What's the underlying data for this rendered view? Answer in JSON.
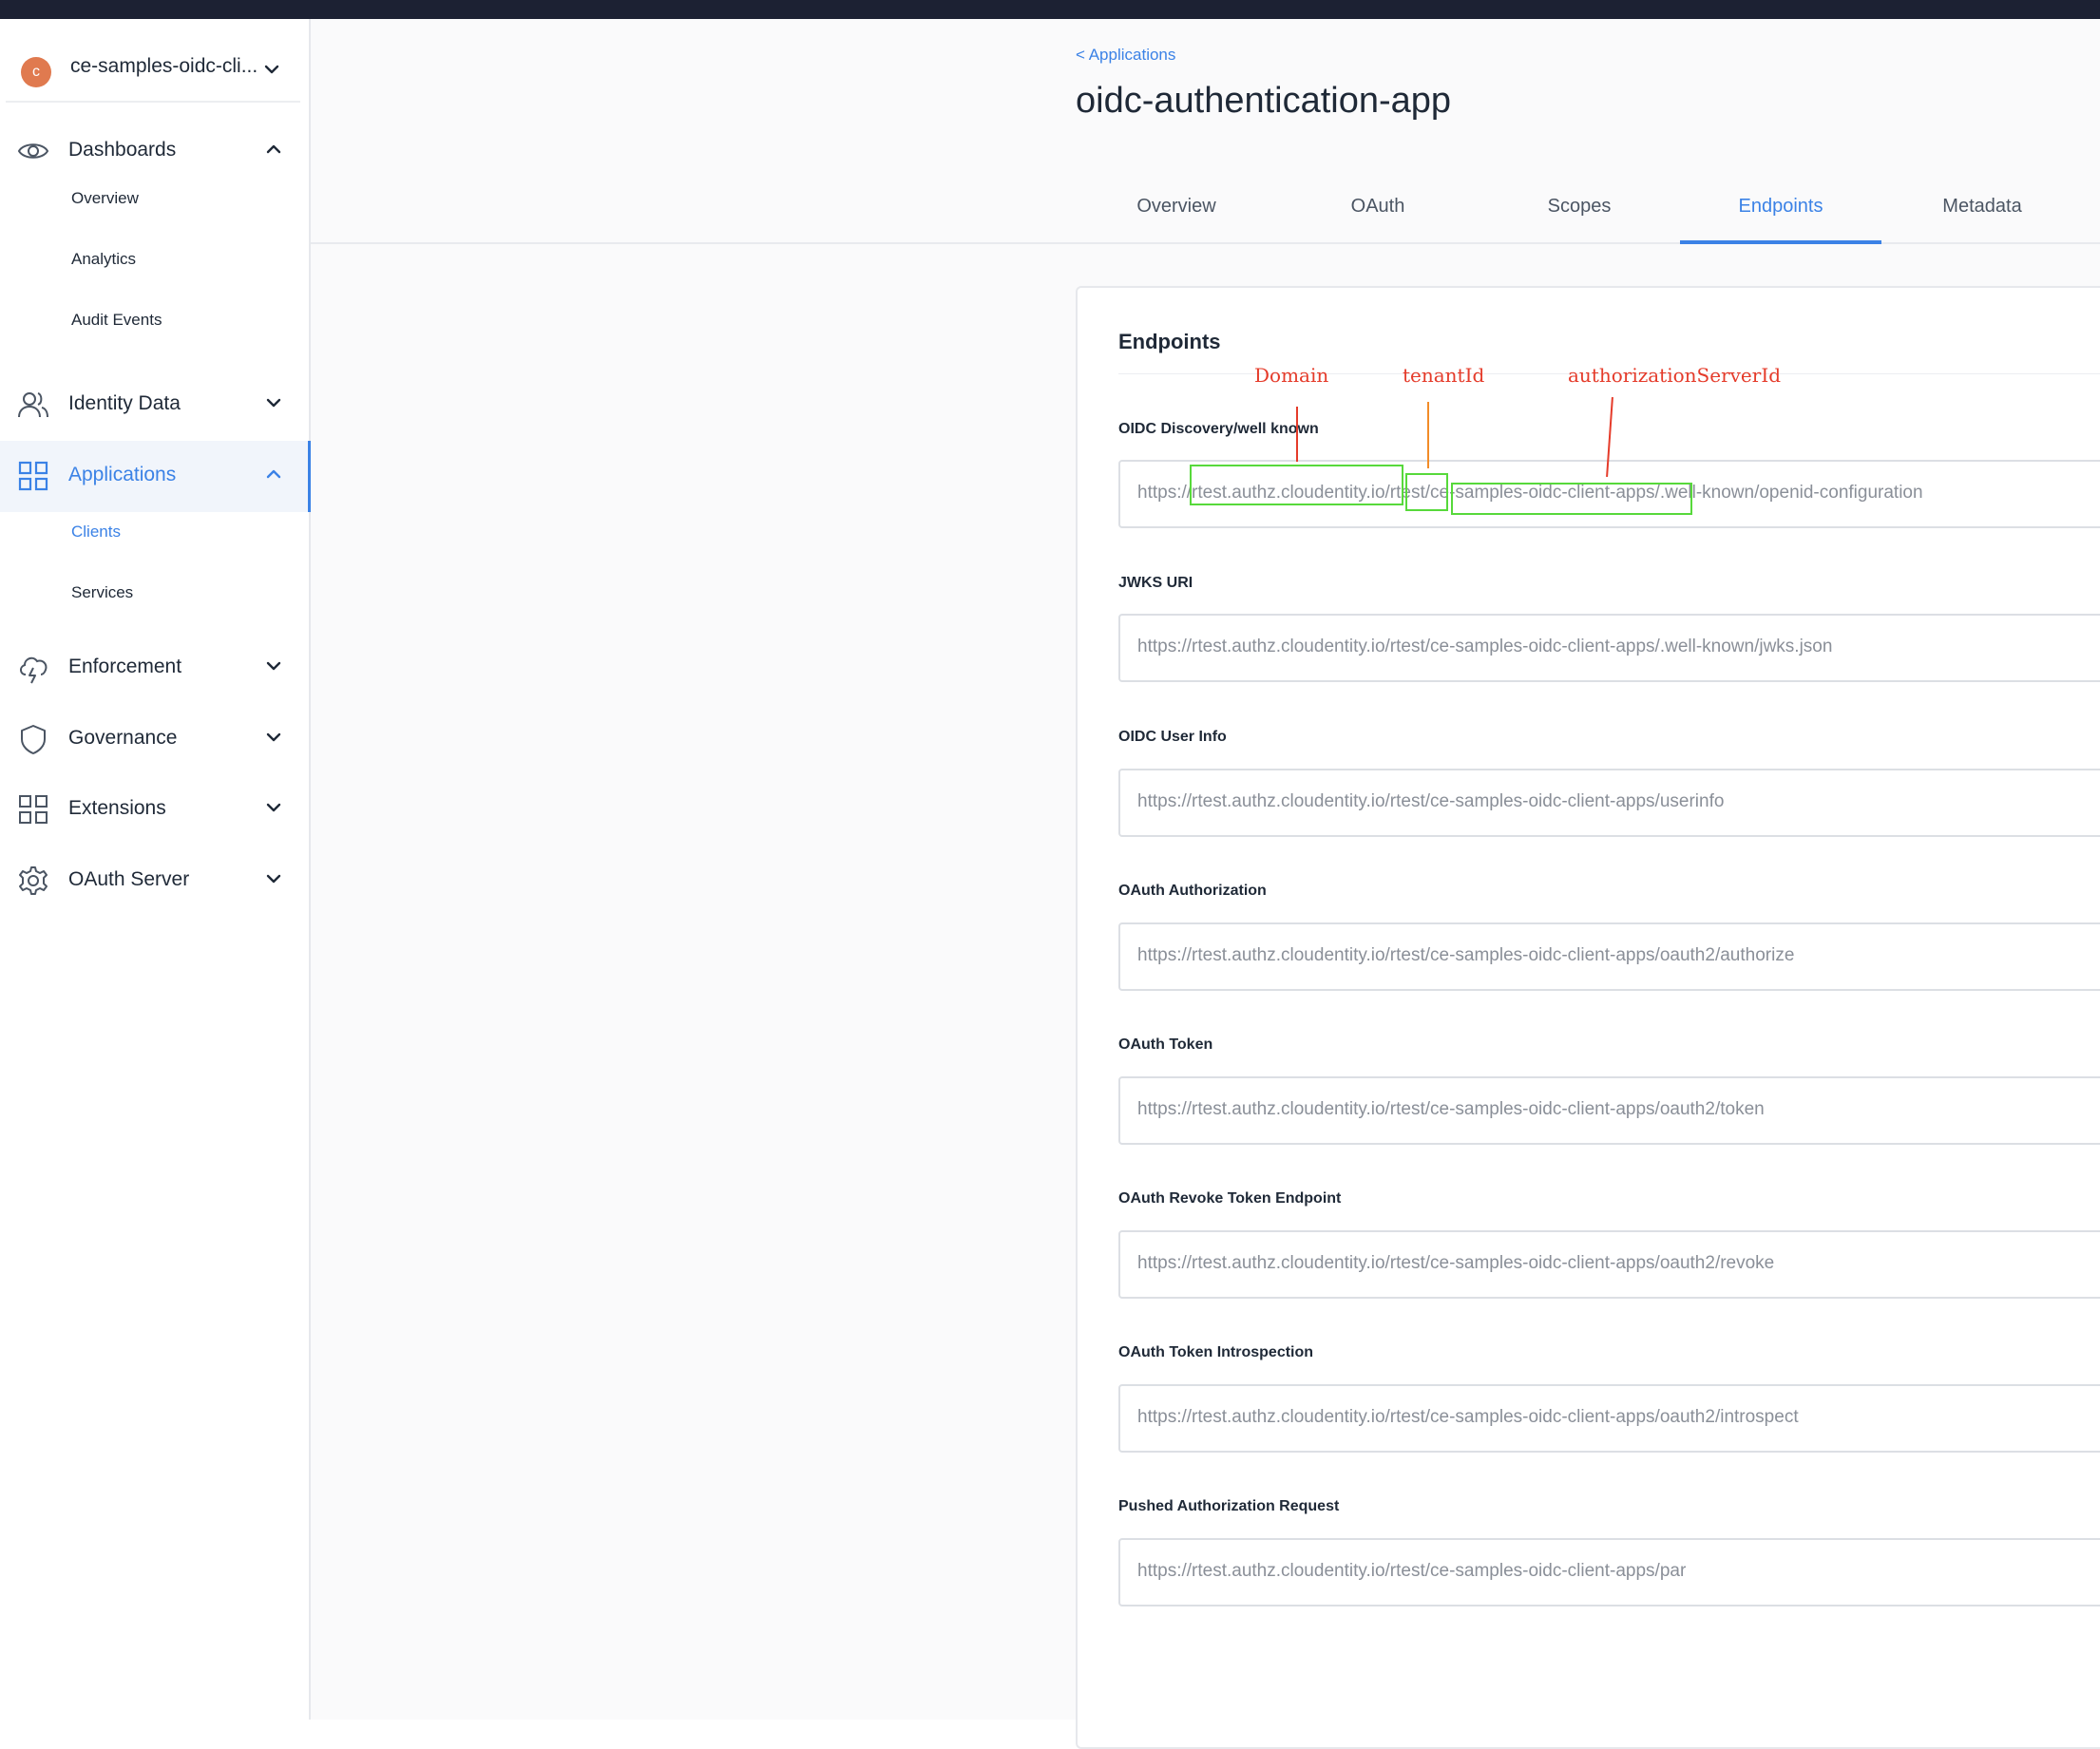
{
  "tenant": {
    "avatar_letter": "c",
    "name": "ce-samples-oidc-cli..."
  },
  "sidebar": {
    "items": [
      {
        "label": "Dashboards"
      },
      {
        "label": "Identity Data"
      },
      {
        "label": "Applications"
      },
      {
        "label": "Enforcement"
      },
      {
        "label": "Governance"
      },
      {
        "label": "Extensions"
      },
      {
        "label": "OAuth Server"
      }
    ],
    "dashboards_sub": [
      "Overview",
      "Analytics",
      "Audit Events"
    ],
    "applications_sub": [
      "Clients",
      "Services"
    ]
  },
  "header": {
    "breadcrumb": "< Applications",
    "title": "oidc-authentication-app",
    "tabs": [
      "Overview",
      "OAuth",
      "Scopes",
      "Endpoints",
      "Metadata"
    ],
    "active_tab": "Endpoints"
  },
  "card": {
    "title": "Endpoints",
    "fields": [
      {
        "label": "OIDC Discovery/well known",
        "value": "https://rtest.authz.cloudentity.io/rtest/ce-samples-oidc-client-apps/.well-known/openid-configuration"
      },
      {
        "label": "JWKS URI",
        "value": "https://rtest.authz.cloudentity.io/rtest/ce-samples-oidc-client-apps/.well-known/jwks.json"
      },
      {
        "label": "OIDC User Info",
        "value": "https://rtest.authz.cloudentity.io/rtest/ce-samples-oidc-client-apps/userinfo"
      },
      {
        "label": "OAuth Authorization",
        "value": "https://rtest.authz.cloudentity.io/rtest/ce-samples-oidc-client-apps/oauth2/authorize"
      },
      {
        "label": "OAuth Token",
        "value": "https://rtest.authz.cloudentity.io/rtest/ce-samples-oidc-client-apps/oauth2/token"
      },
      {
        "label": "OAuth Revoke Token Endpoint",
        "value": "https://rtest.authz.cloudentity.io/rtest/ce-samples-oidc-client-apps/oauth2/revoke"
      },
      {
        "label": "OAuth Token Introspection",
        "value": "https://rtest.authz.cloudentity.io/rtest/ce-samples-oidc-client-apps/oauth2/introspect"
      },
      {
        "label": "Pushed Authorization Request",
        "value": "https://rtest.authz.cloudentity.io/rtest/ce-samples-oidc-client-apps/par"
      }
    ]
  },
  "annotations": {
    "domain": "Domain",
    "tenant_id": "tenantId",
    "authorization_server_id": "authorizationServerId"
  },
  "colors": {
    "accent": "#3b82e6",
    "annotation_red": "#e53b2a",
    "annotation_orange": "#f28c28",
    "annotation_green": "#57d93b",
    "avatar": "#e07a4f"
  }
}
